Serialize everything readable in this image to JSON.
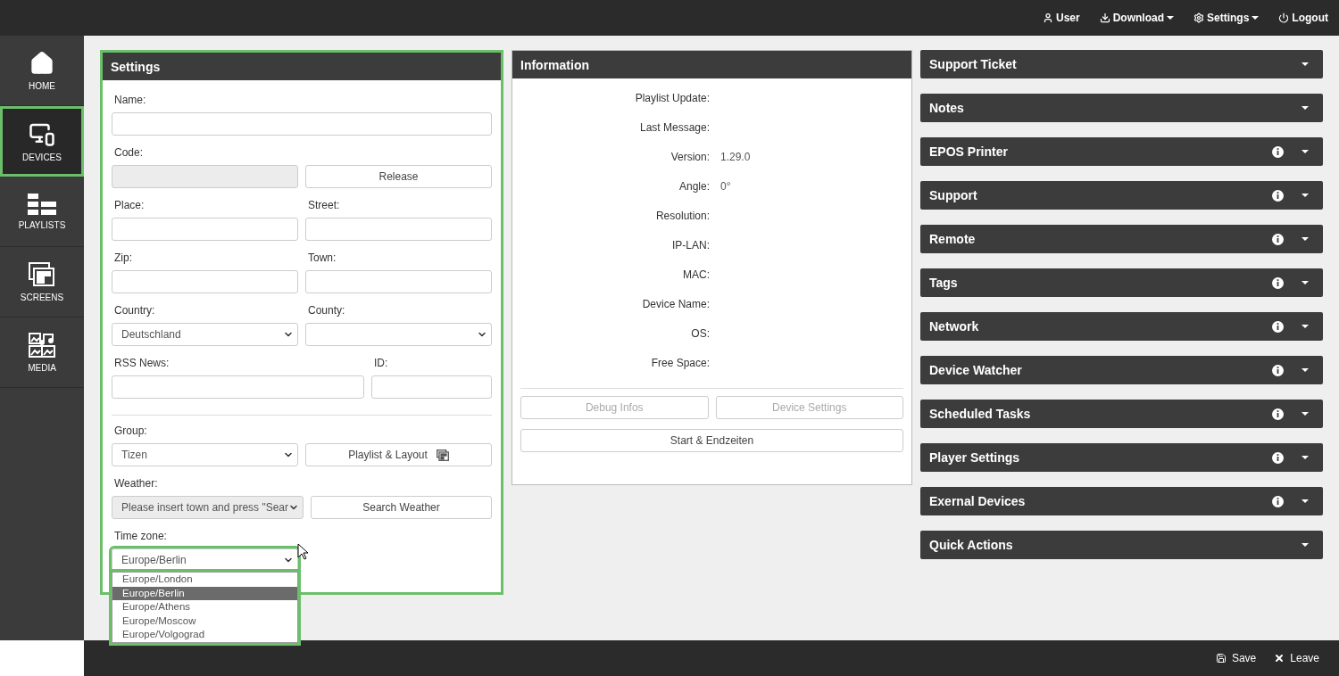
{
  "top_nav": [
    {
      "label": "User",
      "kind": "user",
      "dropdown": false
    },
    {
      "label": "Download",
      "kind": "download",
      "dropdown": true
    },
    {
      "label": "Settings",
      "kind": "settings",
      "dropdown": true
    },
    {
      "label": "Logout",
      "kind": "logout",
      "dropdown": false
    }
  ],
  "sidebar": [
    {
      "label": "HOME",
      "kind": "home",
      "selected": false,
      "highlighted": false
    },
    {
      "label": "DEVICES",
      "kind": "devices",
      "selected": true,
      "highlighted": true
    },
    {
      "label": "PLAYLISTS",
      "kind": "playlists",
      "selected": false,
      "highlighted": false
    },
    {
      "label": "SCREENS",
      "kind": "screens",
      "selected": false,
      "highlighted": false
    },
    {
      "label": "MEDIA",
      "kind": "media",
      "selected": false,
      "highlighted": false
    }
  ],
  "settings_panel": {
    "title": "Settings",
    "highlighted": true,
    "sections": [
      [
        {
          "kind": "full",
          "cells": [
            {
              "label": "Name:",
              "kind": "input",
              "disabled": false
            }
          ]
        },
        {
          "kind": "halves",
          "cells": [
            {
              "label": "Code:",
              "kind": "input",
              "disabled": true
            },
            {
              "kind": "button",
              "text": "Release",
              "icon": false
            }
          ]
        },
        {
          "kind": "halves",
          "cells": [
            {
              "label": "Place:",
              "kind": "input",
              "disabled": false
            },
            {
              "label": "Street:",
              "kind": "input",
              "disabled": false
            }
          ]
        },
        {
          "kind": "halves",
          "cells": [
            {
              "label": "Zip:",
              "kind": "input",
              "disabled": false
            },
            {
              "label": "Town:",
              "kind": "input",
              "disabled": false
            }
          ]
        },
        {
          "kind": "halves",
          "cells": [
            {
              "label": "Country:",
              "kind": "select",
              "value": "Deutschland",
              "disabled": false,
              "open": false
            },
            {
              "label": "County:",
              "kind": "select",
              "disabled": false,
              "open": false
            }
          ]
        },
        {
          "kind": "wide",
          "cells": [
            {
              "label": "RSS News:",
              "kind": "input",
              "disabled": false
            },
            {
              "label": "ID:",
              "kind": "input",
              "disabled": false
            }
          ]
        }
      ],
      [
        {
          "kind": "halves",
          "cells": [
            {
              "label": "Group:",
              "kind": "select",
              "value": "Tizen",
              "disabled": false,
              "open": false
            },
            {
              "kind": "button",
              "text": "Playlist & Layout",
              "icon": true
            }
          ]
        },
        {
          "kind": "halves",
          "cells": [
            {
              "label": "Weather:",
              "kind": "select",
              "value": "Please insert town and press \"Sear",
              "disabled": true,
              "open": false
            },
            {
              "kind": "button",
              "text": "Search Weather",
              "icon": false
            }
          ]
        },
        {
          "kind": "halves",
          "cells": [
            {
              "label": "Time zone:",
              "kind": "select",
              "value": "Europe/Berlin",
              "disabled": false,
              "open": true,
              "highlighted": true,
              "options": [
                {
                  "label": "Europe/London",
                  "selected": false
                },
                {
                  "label": "Europe/Berlin",
                  "selected": true
                },
                {
                  "label": "Europe/Athens",
                  "selected": false
                },
                {
                  "label": "Europe/Moscow",
                  "selected": false
                },
                {
                  "label": "Europe/Volgograd",
                  "selected": false
                }
              ]
            }
          ]
        }
      ]
    ]
  },
  "information_panel": {
    "title": "Information",
    "fields": [
      {
        "label": "Playlist Update:"
      },
      {
        "label": "Last Message:"
      },
      {
        "label": "Version:",
        "value": "1.29.0"
      },
      {
        "label": "Angle:",
        "value": "0°"
      },
      {
        "label": "Resolution:"
      },
      {
        "label": "IP-LAN:"
      },
      {
        "label": "MAC:"
      },
      {
        "label": "Device Name:"
      },
      {
        "label": "OS:"
      },
      {
        "label": "Free Space:"
      }
    ],
    "button_rows": [
      [
        {
          "label": "Debug Infos",
          "disabled": true
        },
        {
          "label": "Device Settings",
          "disabled": true
        }
      ],
      [
        {
          "label": "Start & Endzeiten",
          "disabled": false
        }
      ]
    ]
  },
  "accordions": [
    {
      "title": "Support Ticket",
      "info": false
    },
    {
      "title": "Notes",
      "info": false
    },
    {
      "title": "EPOS Printer",
      "info": true
    },
    {
      "title": "Support",
      "info": true
    },
    {
      "title": "Remote",
      "info": true
    },
    {
      "title": "Tags",
      "info": true
    },
    {
      "title": "Network",
      "info": true
    },
    {
      "title": "Device Watcher",
      "info": true
    },
    {
      "title": "Scheduled Tasks",
      "info": true
    },
    {
      "title": "Player Settings",
      "info": true
    },
    {
      "title": "Exernal Devices",
      "info": true
    },
    {
      "title": "Quick Actions",
      "info": false
    }
  ],
  "bottom_actions": [
    {
      "label": "Save",
      "kind": "save"
    },
    {
      "label": "Leave",
      "kind": "leave"
    }
  ]
}
